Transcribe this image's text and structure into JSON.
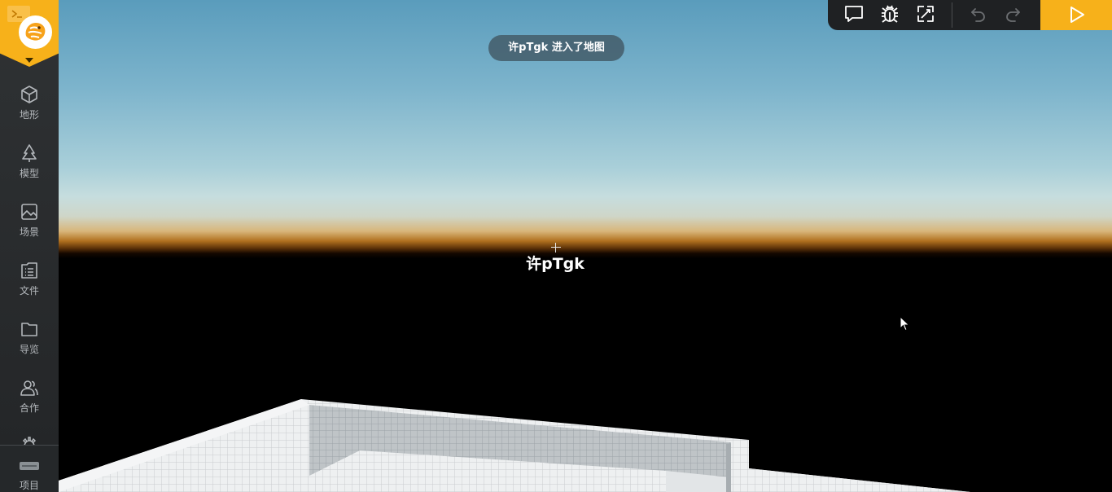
{
  "sidebar": {
    "logo": {
      "icon": "dragon-avatar-icon",
      "accent": "#f7b11a",
      "terminal_icon": "terminal-icon"
    },
    "items": [
      {
        "label": "地形",
        "icon": "cube-icon"
      },
      {
        "label": "模型",
        "icon": "tree-icon"
      },
      {
        "label": "场景",
        "icon": "image-icon"
      },
      {
        "label": "文件",
        "icon": "file-list-icon"
      },
      {
        "label": "导览",
        "icon": "folder-icon"
      },
      {
        "label": "合作",
        "icon": "users-icon"
      }
    ],
    "bottom": {
      "label": "项目",
      "icon": "project-bar-icon"
    }
  },
  "toolbar": {
    "buttons": [
      "chat-icon",
      "bug-icon",
      "expand-icon",
      "undo-icon",
      "redo-icon"
    ],
    "play_icon": "play-icon",
    "play_color": "#f7b11a"
  },
  "viewport": {
    "toast": "许pTgk 进入了地图",
    "player_name": "许pTgk",
    "sky_color": "#5a9cbc",
    "horizon_color": "#b0701e"
  }
}
